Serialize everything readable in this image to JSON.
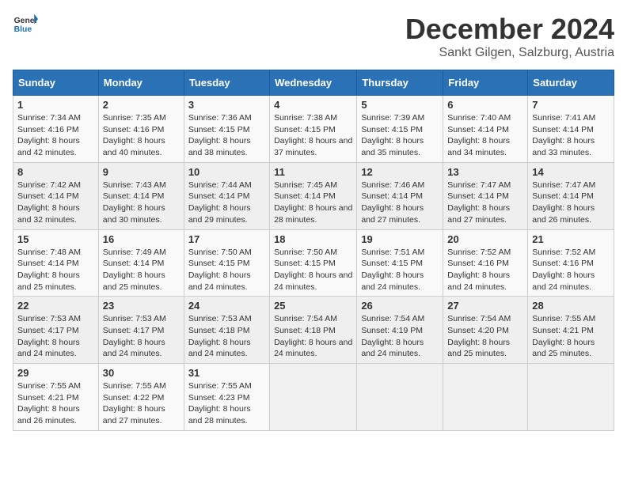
{
  "logo": {
    "general": "General",
    "blue": "Blue"
  },
  "header": {
    "title": "December 2024",
    "subtitle": "Sankt Gilgen, Salzburg, Austria"
  },
  "weekdays": [
    "Sunday",
    "Monday",
    "Tuesday",
    "Wednesday",
    "Thursday",
    "Friday",
    "Saturday"
  ],
  "weeks": [
    [
      {
        "day": "1",
        "sunrise": "7:34 AM",
        "sunset": "4:16 PM",
        "daylight": "8 hours and 42 minutes."
      },
      {
        "day": "2",
        "sunrise": "7:35 AM",
        "sunset": "4:16 PM",
        "daylight": "8 hours and 40 minutes."
      },
      {
        "day": "3",
        "sunrise": "7:36 AM",
        "sunset": "4:15 PM",
        "daylight": "8 hours and 38 minutes."
      },
      {
        "day": "4",
        "sunrise": "7:38 AM",
        "sunset": "4:15 PM",
        "daylight": "8 hours and 37 minutes."
      },
      {
        "day": "5",
        "sunrise": "7:39 AM",
        "sunset": "4:15 PM",
        "daylight": "8 hours and 35 minutes."
      },
      {
        "day": "6",
        "sunrise": "7:40 AM",
        "sunset": "4:14 PM",
        "daylight": "8 hours and 34 minutes."
      },
      {
        "day": "7",
        "sunrise": "7:41 AM",
        "sunset": "4:14 PM",
        "daylight": "8 hours and 33 minutes."
      }
    ],
    [
      {
        "day": "8",
        "sunrise": "7:42 AM",
        "sunset": "4:14 PM",
        "daylight": "8 hours and 32 minutes."
      },
      {
        "day": "9",
        "sunrise": "7:43 AM",
        "sunset": "4:14 PM",
        "daylight": "8 hours and 30 minutes."
      },
      {
        "day": "10",
        "sunrise": "7:44 AM",
        "sunset": "4:14 PM",
        "daylight": "8 hours and 29 minutes."
      },
      {
        "day": "11",
        "sunrise": "7:45 AM",
        "sunset": "4:14 PM",
        "daylight": "8 hours and 28 minutes."
      },
      {
        "day": "12",
        "sunrise": "7:46 AM",
        "sunset": "4:14 PM",
        "daylight": "8 hours and 27 minutes."
      },
      {
        "day": "13",
        "sunrise": "7:47 AM",
        "sunset": "4:14 PM",
        "daylight": "8 hours and 27 minutes."
      },
      {
        "day": "14",
        "sunrise": "7:47 AM",
        "sunset": "4:14 PM",
        "daylight": "8 hours and 26 minutes."
      }
    ],
    [
      {
        "day": "15",
        "sunrise": "7:48 AM",
        "sunset": "4:14 PM",
        "daylight": "8 hours and 25 minutes."
      },
      {
        "day": "16",
        "sunrise": "7:49 AM",
        "sunset": "4:14 PM",
        "daylight": "8 hours and 25 minutes."
      },
      {
        "day": "17",
        "sunrise": "7:50 AM",
        "sunset": "4:15 PM",
        "daylight": "8 hours and 24 minutes."
      },
      {
        "day": "18",
        "sunrise": "7:50 AM",
        "sunset": "4:15 PM",
        "daylight": "8 hours and 24 minutes."
      },
      {
        "day": "19",
        "sunrise": "7:51 AM",
        "sunset": "4:15 PM",
        "daylight": "8 hours and 24 minutes."
      },
      {
        "day": "20",
        "sunrise": "7:52 AM",
        "sunset": "4:16 PM",
        "daylight": "8 hours and 24 minutes."
      },
      {
        "day": "21",
        "sunrise": "7:52 AM",
        "sunset": "4:16 PM",
        "daylight": "8 hours and 24 minutes."
      }
    ],
    [
      {
        "day": "22",
        "sunrise": "7:53 AM",
        "sunset": "4:17 PM",
        "daylight": "8 hours and 24 minutes."
      },
      {
        "day": "23",
        "sunrise": "7:53 AM",
        "sunset": "4:17 PM",
        "daylight": "8 hours and 24 minutes."
      },
      {
        "day": "24",
        "sunrise": "7:53 AM",
        "sunset": "4:18 PM",
        "daylight": "8 hours and 24 minutes."
      },
      {
        "day": "25",
        "sunrise": "7:54 AM",
        "sunset": "4:18 PM",
        "daylight": "8 hours and 24 minutes."
      },
      {
        "day": "26",
        "sunrise": "7:54 AM",
        "sunset": "4:19 PM",
        "daylight": "8 hours and 24 minutes."
      },
      {
        "day": "27",
        "sunrise": "7:54 AM",
        "sunset": "4:20 PM",
        "daylight": "8 hours and 25 minutes."
      },
      {
        "day": "28",
        "sunrise": "7:55 AM",
        "sunset": "4:21 PM",
        "daylight": "8 hours and 25 minutes."
      }
    ],
    [
      {
        "day": "29",
        "sunrise": "7:55 AM",
        "sunset": "4:21 PM",
        "daylight": "8 hours and 26 minutes."
      },
      {
        "day": "30",
        "sunrise": "7:55 AM",
        "sunset": "4:22 PM",
        "daylight": "8 hours and 27 minutes."
      },
      {
        "day": "31",
        "sunrise": "7:55 AM",
        "sunset": "4:23 PM",
        "daylight": "8 hours and 28 minutes."
      },
      null,
      null,
      null,
      null
    ]
  ]
}
